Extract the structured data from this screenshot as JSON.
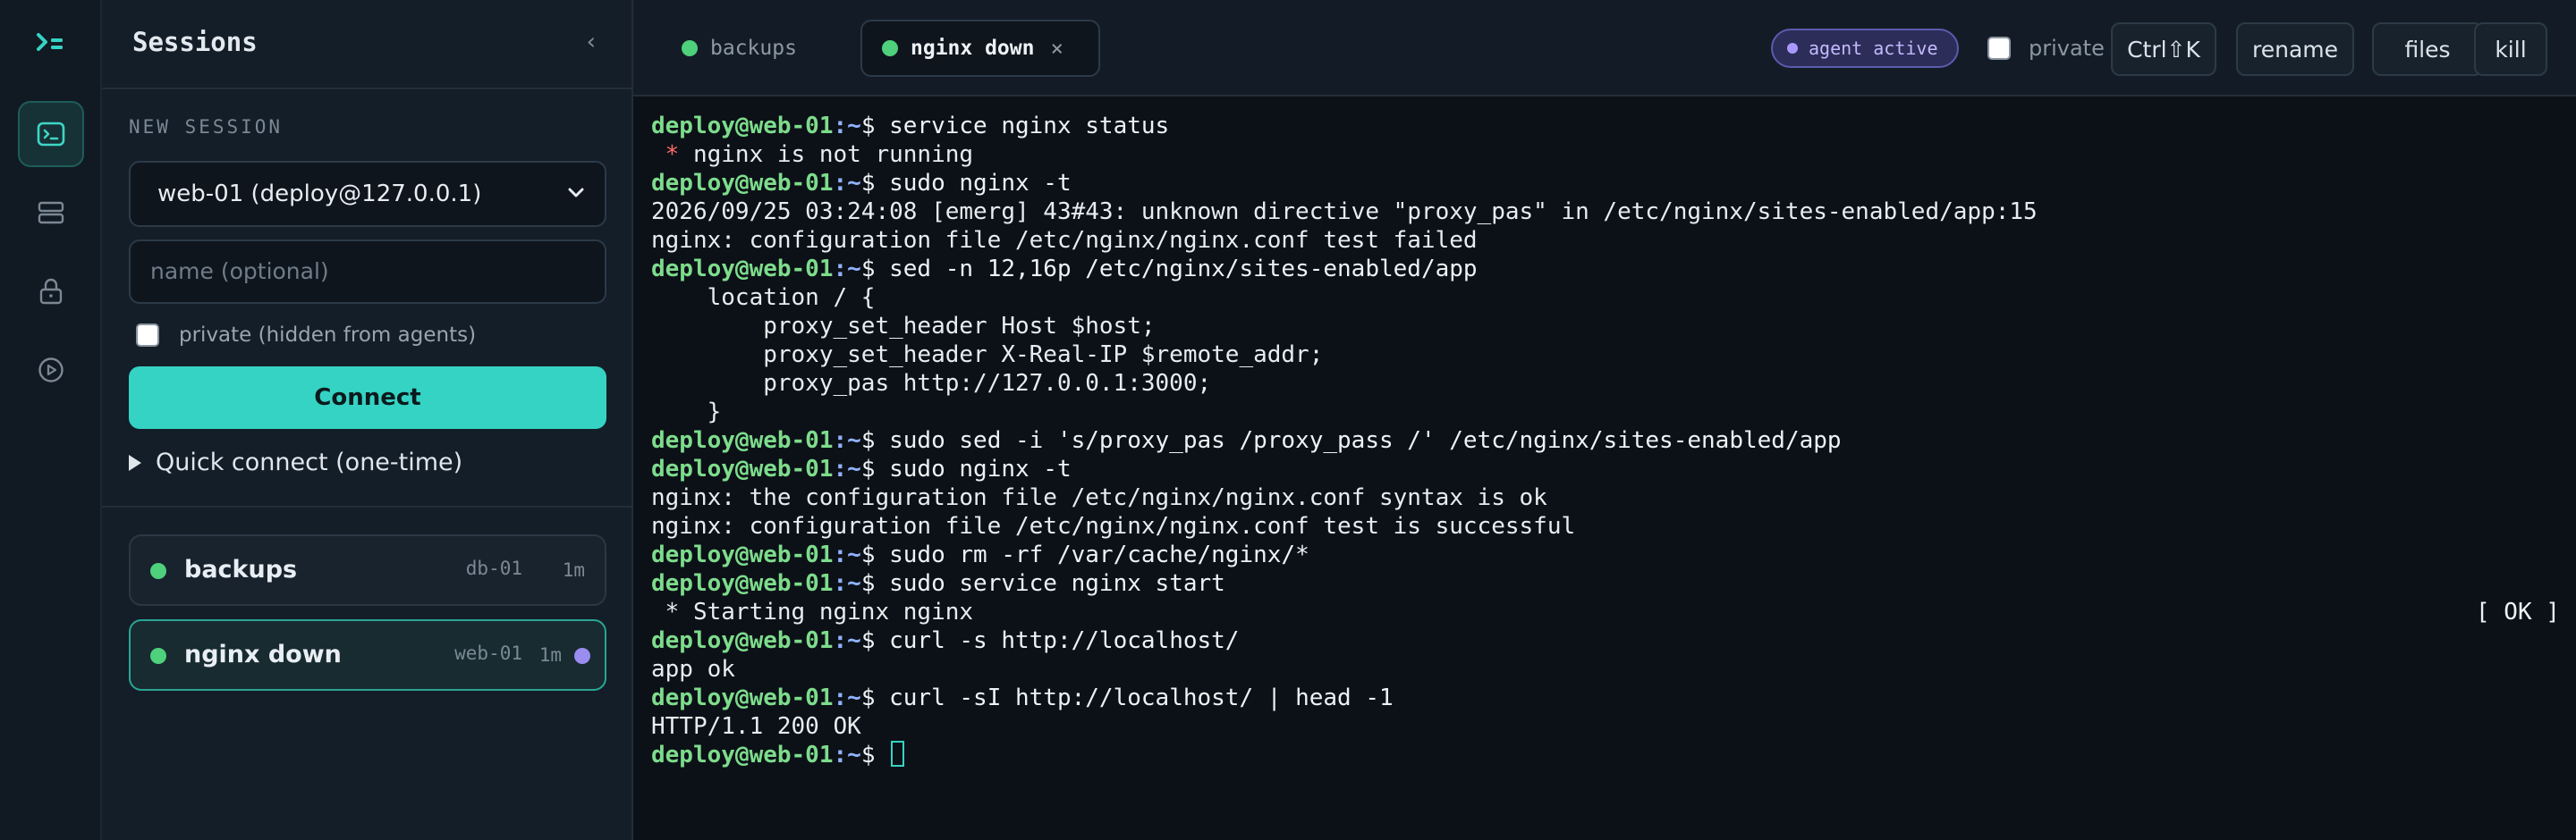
{
  "app": {
    "logo": "terminal-logo-icon",
    "accent": "#35d3c4",
    "rail": [
      {
        "icon": "terminal-icon",
        "active": true
      },
      {
        "icon": "servers-icon",
        "active": false
      },
      {
        "icon": "lock-icon",
        "active": false
      },
      {
        "icon": "play-circle-icon",
        "active": false
      }
    ]
  },
  "sidebar": {
    "title": "Sessions",
    "collapse_glyph": "‹",
    "new_session": {
      "label": "NEW SESSION",
      "host_selected": "web-01 (deploy@127.0.0.1)",
      "name_placeholder": "name (optional)",
      "private_label": "private (hidden from agents)",
      "private_checked": false,
      "connect_label": "Connect",
      "quick_connect_label": "Quick connect (one-time)"
    },
    "sessions": [
      {
        "name": "backups",
        "host": "db-01",
        "age": "1m",
        "status_color": "#4ed07c",
        "agent": false,
        "selected": false
      },
      {
        "name": "nginx down",
        "host": "web-01",
        "age": "1m",
        "status_color": "#4ed07c",
        "agent": true,
        "selected": true
      }
    ]
  },
  "topbar": {
    "tabs": [
      {
        "label": "backups",
        "active": false
      },
      {
        "label": "nginx down",
        "active": true,
        "close_glyph": "×"
      }
    ],
    "agent_badge": "agent active",
    "private_label": "private",
    "private_checked": false,
    "buttons": {
      "shortcut": "Ctrl⇧K",
      "rename": "rename",
      "files": "files",
      "kill": "kill"
    }
  },
  "terminal": {
    "prompt_user": "deploy@web-01",
    "prompt_path": ":~",
    "prompt_sym": "$ ",
    "lines": [
      {
        "type": "cmd",
        "text": "service nginx status"
      },
      {
        "type": "out",
        "star": " * ",
        "text": "nginx is not running"
      },
      {
        "type": "cmd",
        "text": "sudo nginx -t"
      },
      {
        "type": "out",
        "text": "2026/09/25 03:24:08 [emerg] 43#43: unknown directive \"proxy_pas\" in /etc/nginx/sites-enabled/app:15"
      },
      {
        "type": "out",
        "text": "nginx: configuration file /etc/nginx/nginx.conf test failed"
      },
      {
        "type": "cmd",
        "text": "sed -n 12,16p /etc/nginx/sites-enabled/app"
      },
      {
        "type": "out",
        "text": "    location / {"
      },
      {
        "type": "out",
        "text": "        proxy_set_header Host $host;"
      },
      {
        "type": "out",
        "text": "        proxy_set_header X-Real-IP $remote_addr;"
      },
      {
        "type": "out",
        "text": "        proxy_pas http://127.0.0.1:3000;"
      },
      {
        "type": "out",
        "text": "    }"
      },
      {
        "type": "cmd",
        "text": "sudo sed -i 's/proxy_pas /proxy_pass /' /etc/nginx/sites-enabled/app"
      },
      {
        "type": "cmd",
        "text": "sudo nginx -t"
      },
      {
        "type": "out",
        "text": "nginx: the configuration file /etc/nginx/nginx.conf syntax is ok"
      },
      {
        "type": "out",
        "text": "nginx: configuration file /etc/nginx/nginx.conf test is successful"
      },
      {
        "type": "cmd",
        "text": "sudo rm -rf /var/cache/nginx/*"
      },
      {
        "type": "cmd",
        "text": "sudo service nginx start"
      },
      {
        "type": "out",
        "text": " * Starting nginx nginx",
        "ok": "[ OK ]"
      },
      {
        "type": "cmd",
        "text": "curl -s http://localhost/"
      },
      {
        "type": "out",
        "text": "app ok"
      },
      {
        "type": "cmd",
        "text": "curl -sI http://localhost/ | head -1"
      },
      {
        "type": "out",
        "text": "HTTP/1.1 200 OK"
      },
      {
        "type": "prompt",
        "text": ""
      }
    ]
  }
}
